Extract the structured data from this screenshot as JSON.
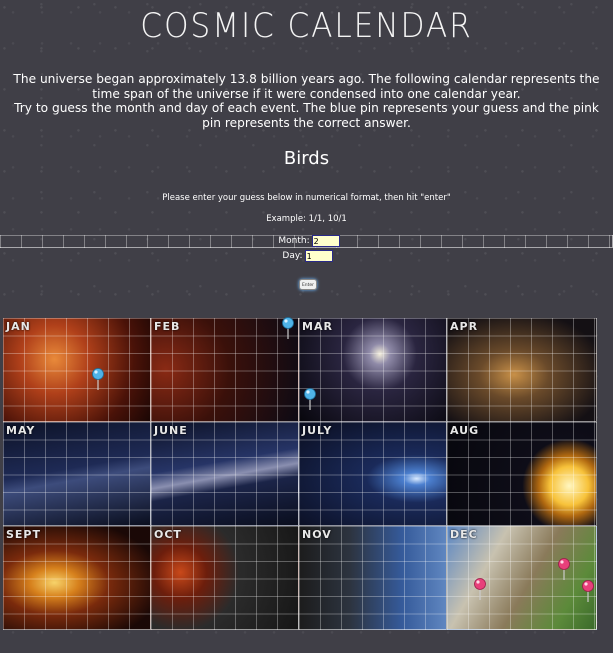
{
  "page": {
    "title": "COSMIC CALENDAR",
    "intro_line1": "The universe began approximately 13.8 billion years ago. The following calendar represents the time span of the universe if it were condensed into one calendar year.",
    "intro_line2": "Try to guess the month and day of each event. The blue pin represents your guess and the pink pin represents the correct answer.",
    "event_name": "Birds",
    "instructions": "Please enter your guess below in numerical format, then hit \"enter\"",
    "example": "Example: 1/1, 10/1"
  },
  "form": {
    "month_label": "Month:",
    "month_value": "2",
    "day_label": "Day:",
    "day_value": "1",
    "enter_label": "Enter"
  },
  "calendar": {
    "months": [
      "JAN",
      "FEB",
      "MAR",
      "APR",
      "MAY",
      "JUNE",
      "JULY",
      "AUG",
      "SEPT",
      "OCT",
      "NOV",
      "DEC"
    ]
  },
  "colors": {
    "background": "#403f47",
    "guess_pin": "#4fb3e8",
    "answer_pin": "#e8407a",
    "input_bg": "#ffffcc"
  }
}
